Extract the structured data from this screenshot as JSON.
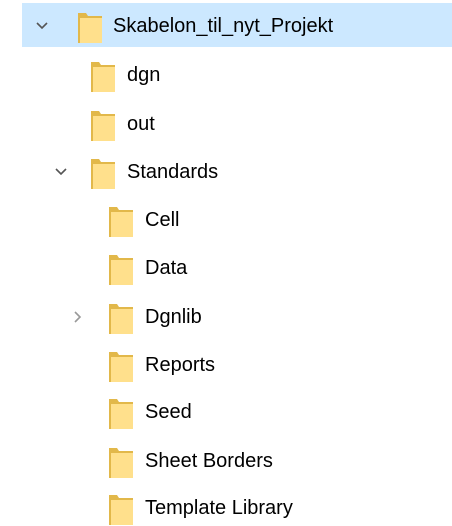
{
  "colors": {
    "selection_bg": "#cce8ff",
    "folder_fill": "#ffe08c",
    "folder_edge": "#e2b84a",
    "chevron": "#555555",
    "chevron_collapsed": "#999999"
  },
  "tree": {
    "items": [
      {
        "label": "Skabelon_til_nyt_Projekt",
        "icon": "folder-icon",
        "expander": "expanded",
        "selected": true
      },
      {
        "label": "dgn",
        "icon": "folder-icon",
        "expander": "none"
      },
      {
        "label": "out",
        "icon": "folder-icon",
        "expander": "none"
      },
      {
        "label": "Standards",
        "icon": "folder-icon",
        "expander": "expanded"
      },
      {
        "label": "Cell",
        "icon": "folder-icon",
        "expander": "none"
      },
      {
        "label": "Data",
        "icon": "folder-icon",
        "expander": "none"
      },
      {
        "label": "Dgnlib",
        "icon": "folder-icon",
        "expander": "collapsed"
      },
      {
        "label": "Reports",
        "icon": "folder-icon",
        "expander": "none"
      },
      {
        "label": "Seed",
        "icon": "folder-icon",
        "expander": "none"
      },
      {
        "label": "Sheet Borders",
        "icon": "folder-icon",
        "expander": "none"
      },
      {
        "label": "Template Library",
        "icon": "folder-icon",
        "expander": "none"
      }
    ]
  }
}
